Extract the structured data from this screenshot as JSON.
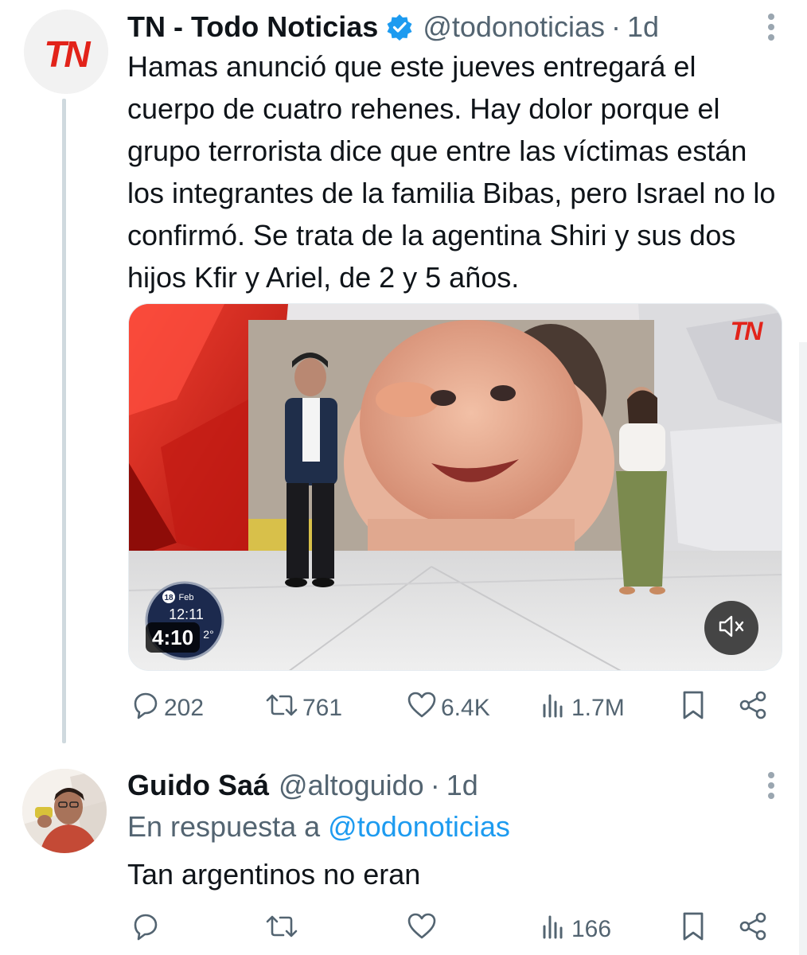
{
  "tweet": {
    "author_name": "TN - Todo Noticias",
    "handle": "@todonoticias",
    "separator": "·",
    "time": "1d",
    "avatar_text": "TN",
    "text": "Hamas anunció que este jueves entregará el cuerpo de cuatro rehenes. Hay dolor porque el grupo terrorista dice que entre las víctimas están los integrantes de la familia Bibas, pero Israel no lo confirmó. Se trata de la agentina Shiri y sus dos hijos Kfir y Ariel, de 2 y 5 años.",
    "video": {
      "channel_logo": "TN",
      "clock_day": "18",
      "clock_month": "Feb",
      "clock_time": "12:11",
      "clock_temp": "2°",
      "duration": "4:10"
    },
    "actions": {
      "replies": "202",
      "retweets": "761",
      "likes": "6.4K",
      "views": "1.7M"
    }
  },
  "reply": {
    "author_name": "Guido Saá",
    "handle": "@altoguido",
    "separator": "·",
    "time": "1d",
    "reply_prefix": "En respuesta a",
    "reply_to": "@todonoticias",
    "text": "Tan argentinos no eran",
    "actions": {
      "replies": "",
      "retweets": "",
      "likes": "",
      "views": "166"
    }
  },
  "colors": {
    "text": "#0f1419",
    "muted": "#536471",
    "link": "#1d9bf0",
    "brand_red": "#e2231a",
    "thread_line": "#cfd9de"
  },
  "icons": [
    "verified-badge-icon",
    "more-options-icon",
    "reply-icon",
    "retweet-icon",
    "like-icon",
    "views-icon",
    "bookmark-icon",
    "share-icon",
    "mute-icon"
  ]
}
